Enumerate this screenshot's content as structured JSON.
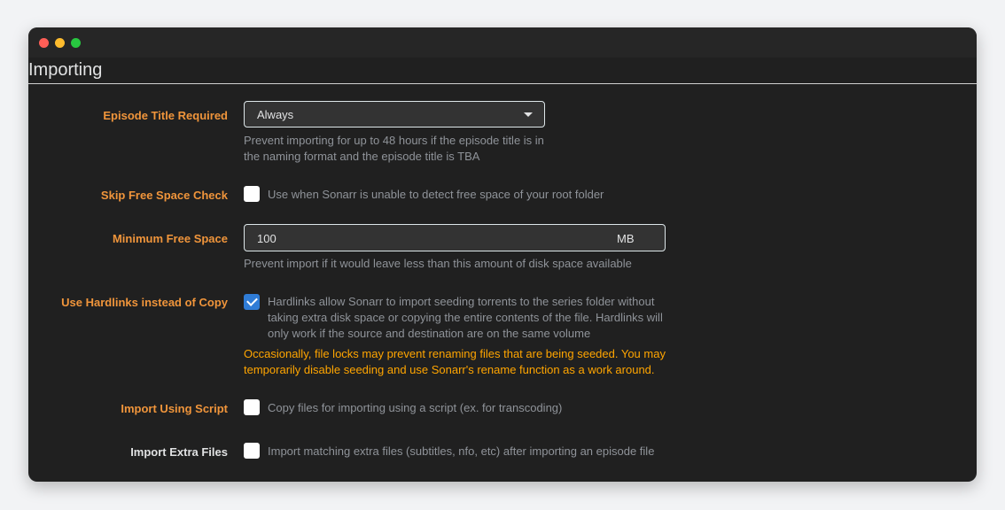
{
  "section": {
    "title": "Importing"
  },
  "episode_title": {
    "label": "Episode Title Required",
    "value": "Always",
    "help_line1": "Prevent importing for up to 48 hours if the episode title is in",
    "help_line2": "the naming format and the episode title is TBA"
  },
  "skip_free_space": {
    "label": "Skip Free Space Check",
    "checked": false,
    "help": "Use when Sonarr is unable to detect free space of your root folder"
  },
  "min_free_space": {
    "label": "Minimum Free Space",
    "value": "100",
    "unit": "MB",
    "help": "Prevent import if it would leave less than this amount of disk space available"
  },
  "hardlinks": {
    "label": "Use Hardlinks instead of Copy",
    "checked": true,
    "help_line1": "Hardlinks allow Sonarr to import seeding torrents to the series folder without",
    "help_line2": "taking extra disk space or copying the entire contents of the file. Hardlinks will",
    "help_line3": "only work if the source and destination are on the same volume",
    "warning_line1": "Occasionally, file locks may prevent renaming files that are being seeded. You may",
    "warning_line2": "temporarily disable seeding and use Sonarr's rename function as a work around."
  },
  "import_script": {
    "label": "Import Using Script",
    "checked": false,
    "help": "Copy files for importing using a script (ex. for transcoding)"
  },
  "extra_files": {
    "label": "Import Extra Files",
    "checked": false,
    "help": "Import matching extra files (subtitles, nfo, etc) after importing an episode file"
  },
  "colors": {
    "accent_label": "#f0953b",
    "warning": "#ffa500",
    "checkbox_checked": "#2f7cd6",
    "window_bg": "#202020"
  }
}
